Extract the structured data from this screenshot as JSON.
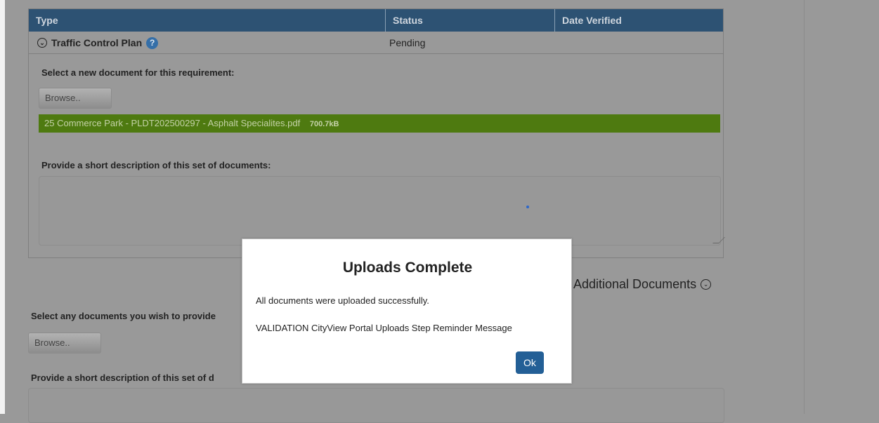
{
  "table": {
    "headers": {
      "type": "Type",
      "status": "Status",
      "date_verified": "Date Verified"
    },
    "row": {
      "type": "Traffic Control Plan",
      "status": "Pending"
    }
  },
  "requirement": {
    "select_label": "Select a new document for this requirement:",
    "browse_label": "Browse..",
    "file_name": "25 Commerce Park - PLDT202500297 - Asphalt Specialites.pdf",
    "file_size": "700.7kB",
    "description_label": "Provide a short description of this set of documents:"
  },
  "additional": {
    "heading": "Additional Documents",
    "select_label": "Select any documents you wish to provide",
    "browse_label": "Browse..",
    "description_label": "Provide a short description of this set of d"
  },
  "modal": {
    "title": "Uploads Complete",
    "message": "All documents were uploaded successfully.",
    "reminder": "VALIDATION CityView Portal Uploads Step Reminder Message",
    "ok_label": "Ok"
  },
  "colors": {
    "header_bg": "#2d5273",
    "file_bar": "#4e7a10",
    "ok_button": "#235f96",
    "overlay": "#999999"
  }
}
